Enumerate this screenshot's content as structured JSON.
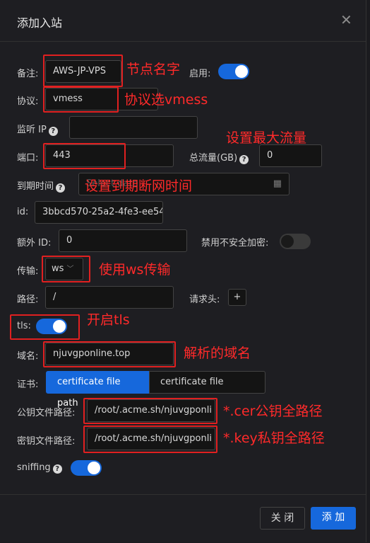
{
  "dialog": {
    "title": "添加入站"
  },
  "fields": {
    "remark": {
      "label": "备注:",
      "value": "AWS-JP-VPS"
    },
    "enable": {
      "label": "启用:",
      "on": true
    },
    "protocol": {
      "label": "协议:",
      "value": "vmess"
    },
    "listen_ip": {
      "label": "监听 IP",
      "value": ""
    },
    "port": {
      "label": "端口:",
      "value": "443"
    },
    "total_traffic": {
      "label": "总流量(GB)",
      "value": "0"
    },
    "expiry": {
      "label": "到期时间",
      "placeholder": "Select date"
    },
    "id": {
      "label": "id:",
      "value": "3bbcd570-25a2-4fe3-ee54"
    },
    "alter_id": {
      "label": "额外 ID:",
      "value": "0"
    },
    "disable_insecure": {
      "label": "禁用不安全加密:",
      "on": false
    },
    "network": {
      "label": "传输:",
      "value": "ws"
    },
    "path": {
      "label": "路径:",
      "value": "/"
    },
    "headers": {
      "label": "请求头:",
      "add": "+"
    },
    "tls": {
      "label": "tls:",
      "on": true
    },
    "domain": {
      "label": "域名:",
      "value": "njuvgponline.top"
    },
    "cert": {
      "label": "证书:",
      "options": [
        "certificate file path",
        "certificate file content"
      ],
      "selected": 0
    },
    "cert_file": {
      "label": "公钥文件路径:",
      "value": "/root/.acme.sh/njuvgponli"
    },
    "key_file": {
      "label": "密钥文件路径:",
      "value": "/root/.acme.sh/njuvgponli"
    },
    "sniffing": {
      "label": "sniffing",
      "on": true
    }
  },
  "annotations": {
    "node_name": "节点名字",
    "protocol": "协议选vmess",
    "max_traffic": "设置最大流量",
    "expiry": "设置到期断网时间",
    "ws": "使用ws传输",
    "tls": "开启tls",
    "domain": "解析的域名",
    "cer": "*.cer公钥全路径",
    "key": "*.key私钥全路径"
  },
  "footer": {
    "close": "关 闭",
    "add": "添 加"
  },
  "colors": {
    "primary": "#1668dc",
    "annotation": "#ff2a2a",
    "background": "#1e1e22"
  }
}
